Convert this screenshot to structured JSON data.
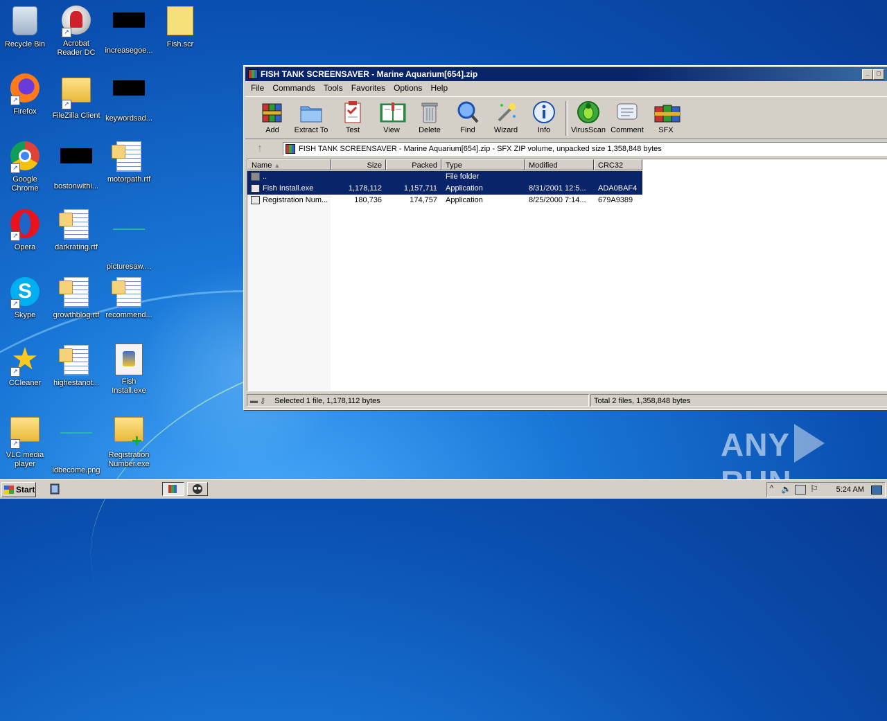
{
  "desktop": {
    "icons": [
      {
        "label": "Recycle Bin"
      },
      {
        "label": "Acrobat Reader DC"
      },
      {
        "label": "increasegoe..."
      },
      {
        "label": "Fish.scr"
      },
      {
        "label": "Firefox"
      },
      {
        "label": "FileZilla Client"
      },
      {
        "label": "keywordsad..."
      },
      {
        "label": "Google Chrome"
      },
      {
        "label": "bostonwithi..."
      },
      {
        "label": "motorpath.rtf"
      },
      {
        "label": "Opera"
      },
      {
        "label": "darkrating.rtf"
      },
      {
        "label": "picturesaw...."
      },
      {
        "label": "Skype"
      },
      {
        "label": "growthblog.rtf"
      },
      {
        "label": "recommend..."
      },
      {
        "label": "CCleaner"
      },
      {
        "label": "highestanot..."
      },
      {
        "label": "Fish Install.exe"
      },
      {
        "label": "VLC media player"
      },
      {
        "label": "idbecome.png"
      },
      {
        "label": "Registration Number.exe"
      }
    ]
  },
  "window": {
    "title": "FISH TANK SCREENSAVER - Marine Aquarium[654].zip",
    "menu": [
      "File",
      "Commands",
      "Tools",
      "Favorites",
      "Options",
      "Help"
    ],
    "toolbar": [
      {
        "label": "Add",
        "icon": "add-archive-icon"
      },
      {
        "label": "Extract To",
        "icon": "extract-folder-icon"
      },
      {
        "label": "Test",
        "icon": "test-clipboard-icon"
      },
      {
        "label": "View",
        "icon": "view-book-icon"
      },
      {
        "label": "Delete",
        "icon": "trash-icon"
      },
      {
        "label": "Find",
        "icon": "magnifier-icon"
      },
      {
        "label": "Wizard",
        "icon": "wand-icon"
      },
      {
        "label": "Info",
        "icon": "info-icon"
      },
      {
        "label": "VirusScan",
        "icon": "bug-icon"
      },
      {
        "label": "Comment",
        "icon": "comment-icon"
      },
      {
        "label": "SFX",
        "icon": "sfx-books-icon"
      }
    ],
    "address": "FISH TANK SCREENSAVER - Marine Aquarium[654].zip - SFX ZIP volume, unpacked size 1,358,848 bytes",
    "columns": [
      "Name",
      "Size",
      "Packed",
      "Type",
      "Modified",
      "CRC32"
    ],
    "rows": [
      {
        "name": "..",
        "size": "",
        "packed": "",
        "type": "File folder",
        "modified": "",
        "crc": "",
        "selected": true
      },
      {
        "name": "Fish Install.exe",
        "size": "1,178,112",
        "packed": "1,157,711",
        "type": "Application",
        "modified": "8/31/2001 12:5...",
        "crc": "ADA0BAF4",
        "selected": true
      },
      {
        "name": "Registration Num...",
        "size": "180,736",
        "packed": "174,757",
        "type": "Application",
        "modified": "8/25/2000 7:14...",
        "crc": "679A9389",
        "selected": false
      }
    ],
    "status_left": "Selected 1 file, 1,178,112 bytes",
    "status_right": "Total 2 files, 1,358,848 bytes"
  },
  "taskbar": {
    "start_label": "Start",
    "clock": "5:24 AM"
  },
  "watermark": {
    "left": "ANY",
    "right": "RUN"
  },
  "colors": {
    "selection": "#0a246a",
    "titlebar": "#0a246a",
    "chrome": "#d4d0c8"
  }
}
